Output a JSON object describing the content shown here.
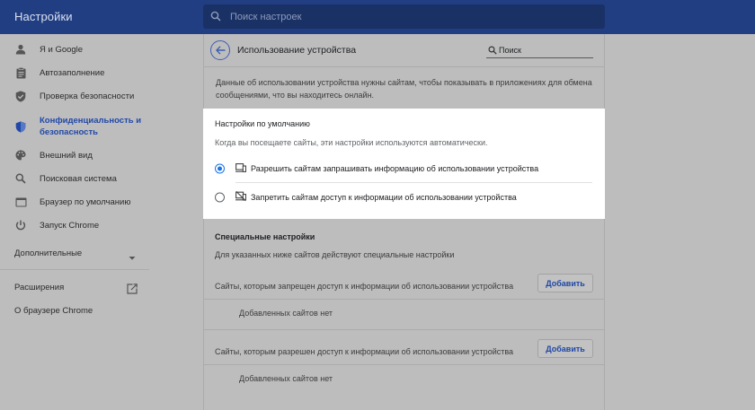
{
  "header": {
    "app_title": "Настройки",
    "search_placeholder": "Поиск настроек"
  },
  "sidebar": {
    "items": [
      {
        "label": "Я и Google",
        "icon": "person-icon"
      },
      {
        "label": "Автозаполнение",
        "icon": "clipboard-icon"
      },
      {
        "label": "Проверка безопасности",
        "icon": "shield-check-icon"
      },
      {
        "label_line1": "Конфиденциальность и",
        "label_line2": "безопасность",
        "icon": "shield-icon",
        "active": true
      },
      {
        "label": "Внешний вид",
        "icon": "palette-icon"
      },
      {
        "label": "Поисковая система",
        "icon": "search-icon"
      },
      {
        "label": "Браузер по умолчанию",
        "icon": "browser-icon"
      },
      {
        "label": "Запуск Chrome",
        "icon": "power-icon"
      }
    ],
    "advanced": "Дополнительные",
    "extensions": "Расширения",
    "about": "О браузере Chrome"
  },
  "page": {
    "title": "Использование устройства",
    "search_placeholder": "Поиск",
    "description": "Данные об использовании устройства нужны сайтам, чтобы показывать в приложениях для обмена сообщениями, что вы находитесь онлайн."
  },
  "defaults": {
    "heading": "Настройки по умолчанию",
    "subtext": "Когда вы посещаете сайты, эти настройки используются автоматически.",
    "options": [
      {
        "label": "Разрешить сайтам запрашивать информацию об использовании устройства",
        "checked": true,
        "icon": "device-icon"
      },
      {
        "label": "Запретить сайтам доступ к информации об использовании устройства",
        "checked": false,
        "icon": "device-off-icon"
      }
    ]
  },
  "custom": {
    "heading": "Специальные настройки",
    "subtext": "Для указанных ниже сайтов действуют специальные настройки",
    "blocked_label": "Сайты, которым запрещен доступ к информации об использовании устройства",
    "allowed_label": "Сайты, которым разрешен доступ к информации об использовании устройства",
    "empty_text": "Добавленных сайтов нет",
    "add_button": "Добавить"
  },
  "colors": {
    "header_bg": "#213e82",
    "accent": "#1a73e8",
    "active_nav": "#2148a8",
    "overlay_bg": "#bdbdbd",
    "card_bg": "#ffffff"
  }
}
